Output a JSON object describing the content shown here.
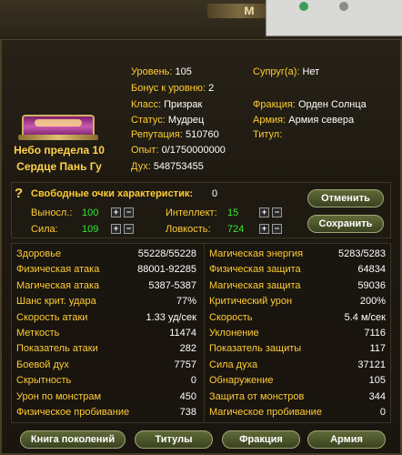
{
  "title_glyph": "м",
  "guild": {
    "line1": "Небо предела 10",
    "line2": "Сердце Пань Гу"
  },
  "info_left": [
    {
      "label": "Уровень:",
      "value": "105"
    },
    {
      "label": "Бонус к уровню:",
      "value": "2"
    },
    {
      "label": "Класс:",
      "value": "Призрак"
    },
    {
      "label": "Статус:",
      "value": "Мудрец"
    },
    {
      "label": "Репутация:",
      "value": "510760"
    },
    {
      "label": "Опыт:",
      "value": "0/1750000000"
    },
    {
      "label": "Дух:",
      "value": "548753455"
    }
  ],
  "info_right": [
    {
      "label": "Супруг(а):",
      "value": "Нет"
    },
    {
      "label": "Фракция:",
      "value": "Орден Солнца"
    },
    {
      "label": "Армия:",
      "value": "Армия севера"
    },
    {
      "label": "Титул:",
      "value": ""
    }
  ],
  "attributes": {
    "title": "Свободные очки характеристик:",
    "free_points": "0",
    "items": [
      {
        "label": "Выносл.:",
        "value": "100"
      },
      {
        "label": "Сила:",
        "value": "109"
      },
      {
        "label": "Интеллект:",
        "value": "15"
      },
      {
        "label": "Ловкость:",
        "value": "724"
      }
    ],
    "cancel_label": "Отменить",
    "save_label": "Сохранить"
  },
  "stats_left": [
    {
      "label": "Здоровье",
      "value": "55228/55228"
    },
    {
      "label": "Физическая атака",
      "value": "88001-92285"
    },
    {
      "label": "Магическая атака",
      "value": "5387-5387"
    },
    {
      "label": "Шанс крит. удара",
      "value": "77%"
    },
    {
      "label": "Скорость атаки",
      "value": "1.33 уд/сек"
    },
    {
      "label": "Меткость",
      "value": "11474"
    },
    {
      "label": "Показатель атаки",
      "value": "282"
    },
    {
      "label": "Боевой дух",
      "value": "7757"
    },
    {
      "label": "Скрытность",
      "value": "0"
    },
    {
      "label": "Урон по монстрам",
      "value": "450"
    },
    {
      "label": "Физическое пробивание",
      "value": "738"
    }
  ],
  "stats_right": [
    {
      "label": "Магическая энергия",
      "value": "5283/5283"
    },
    {
      "label": "Физическая защита",
      "value": "64834"
    },
    {
      "label": "Магическая защита",
      "value": "59036"
    },
    {
      "label": "Критический урон",
      "value": "200%"
    },
    {
      "label": "Скорость",
      "value": "5.4 м/сек"
    },
    {
      "label": "Уклонение",
      "value": "7116"
    },
    {
      "label": "Показатель защиты",
      "value": "117"
    },
    {
      "label": "Сила духа",
      "value": "37121"
    },
    {
      "label": "Обнаружение",
      "value": "105"
    },
    {
      "label": "Защита от монстров",
      "value": "344"
    },
    {
      "label": "Магическое пробивание",
      "value": "0"
    }
  ],
  "tabs": [
    "Книга поколений",
    "Титулы",
    "Фракция",
    "Армия"
  ]
}
